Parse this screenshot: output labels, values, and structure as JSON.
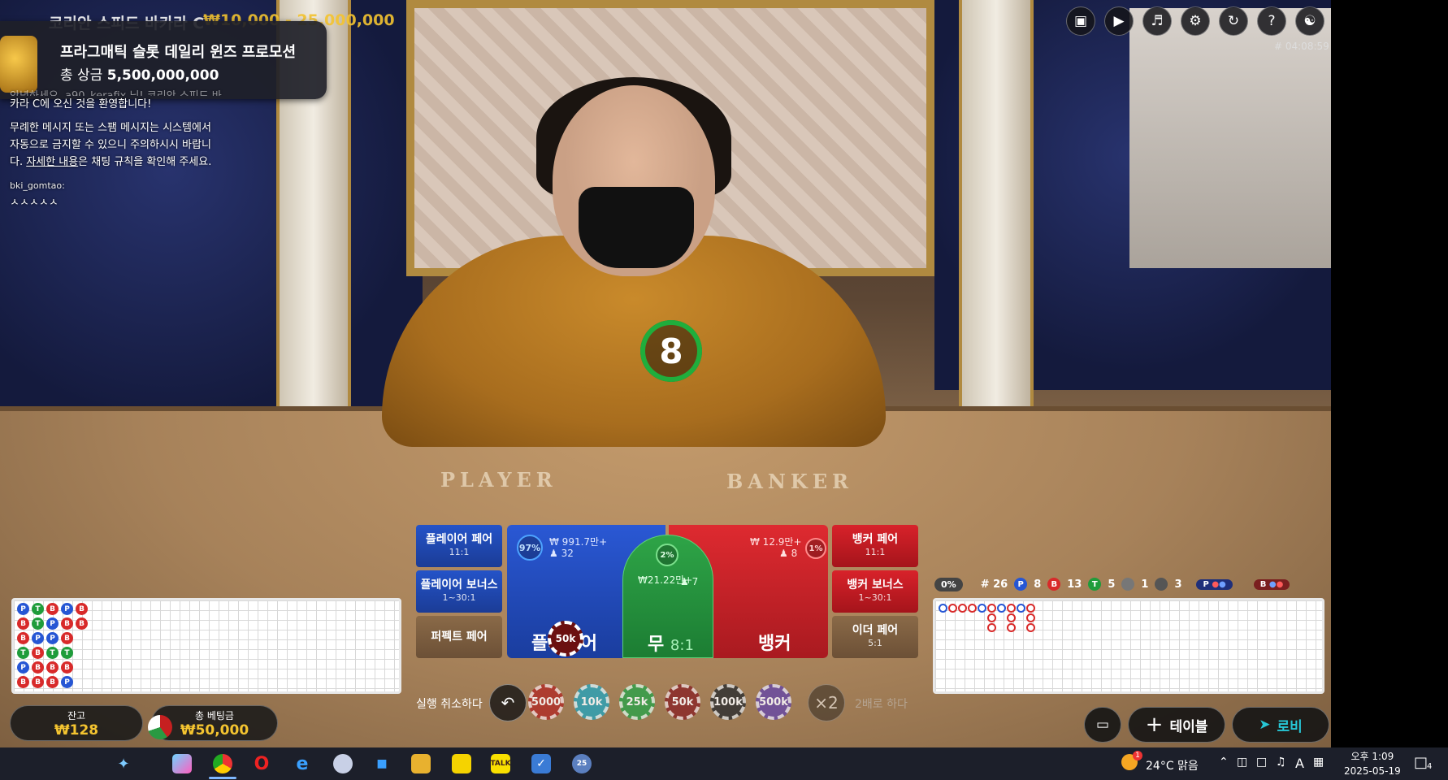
{
  "header": {
    "title": "코리안 스피드 바카라 C",
    "bet_limit": "₩10,000 - 25,000,000",
    "timestamp": "# 04:08:59"
  },
  "toolbar_icons": [
    "chat-icon",
    "video-icon",
    "sound-icon",
    "settings-icon",
    "history-icon",
    "help-icon",
    "headset-icon"
  ],
  "promo": {
    "title": "프라그매틱 슬롯 데일리 윈즈 프로모션",
    "prize_label": "총 상금",
    "prize_value": "5,500,000,000"
  },
  "chat": {
    "welcome_partial": "안녕하세요, a90_kerafix 님! 코리안 스피드 바",
    "welcome_line2": "카라 C에 오신 것을 환영합니다!",
    "notice_line1": "무례한 메시지 또는 스팸 메시지는 시스템에서",
    "notice_line2": "자동으로 금지할 수 있으니 주의하시시 바랍니",
    "notice_line3_a": "다. ",
    "notice_link": "자세한 내용",
    "notice_line3_b": "은 채팅 규칙을 확인해 주세요.",
    "user": "bki_gomtao:",
    "message": "ㅅㅅㅅㅅㅅ"
  },
  "felt": {
    "player": "PLAYER",
    "banker": "BANKER"
  },
  "timer": {
    "seconds": "8"
  },
  "side_bets": {
    "player_pair": {
      "label": "플레이어 페어",
      "odds": "11:1"
    },
    "player_bonus": {
      "label": "플레이어 보너스",
      "odds": "1~30:1"
    },
    "perfect_pair": {
      "label": "퍼펙트 페어"
    },
    "banker_pair": {
      "label": "뱅커 페어",
      "odds": "11:1"
    },
    "banker_bonus": {
      "label": "뱅커 보너스",
      "odds": "1~30:1"
    },
    "either_pair": {
      "label": "이더 페어",
      "odds": "5:1"
    }
  },
  "main_bets": {
    "player": {
      "label": "플레이어",
      "pct": "97%",
      "amount": "₩ 991.7만+",
      "players": "32"
    },
    "tie": {
      "label": "무",
      "odds": "8:1",
      "pct": "2%",
      "amount": "₩21.22만+",
      "players": "7"
    },
    "banker": {
      "label": "뱅커",
      "pct": "1%",
      "amount": "₩ 12.9만+",
      "players": "8"
    },
    "placed_chip": "50k"
  },
  "road_stats": {
    "zero_badge": "0%",
    "round": "# 26",
    "p_count": "8",
    "b_count": "13",
    "t_count": "5",
    "p_pair": "1",
    "b_pair": "3",
    "p_predict": "P",
    "b_predict": "B"
  },
  "bead_road": [
    [
      "P",
      "B",
      "B",
      "T",
      "P",
      "B"
    ],
    [
      "T",
      "T",
      "P",
      "B",
      "B",
      "B"
    ],
    [
      "B",
      "P",
      "P",
      "T",
      "B",
      "B"
    ],
    [
      "P",
      "B",
      "B",
      "T",
      "B",
      "P"
    ],
    [
      "B",
      "B",
      "",
      "",
      "",
      ""
    ]
  ],
  "wallet": {
    "balance_label": "잔고",
    "balance_value": "₩128",
    "total_bet_label": "총 베팅금",
    "total_bet_value": "₩50,000"
  },
  "controls": {
    "undo_label": "실행 취소하다",
    "undo_icon": "undo-icon",
    "double_icon_text": "×2",
    "double_label": "2배로 하다"
  },
  "chips": [
    {
      "label": "5000",
      "color": "#b0312a"
    },
    {
      "label": "10k",
      "color": "#2fa1b4"
    },
    {
      "label": "25k",
      "color": "#33a04a"
    },
    {
      "label": "50k",
      "color": "#8b2a2a"
    },
    {
      "label": "100k",
      "color": "#333333"
    },
    {
      "label": "500k",
      "color": "#6a4ba3"
    }
  ],
  "nav": {
    "table_label": "테이블",
    "lobby_label": "로비"
  },
  "taskbar": {
    "weather": "24°C 맑음",
    "time": "오후 1:09",
    "date": "2025-05-19",
    "notification_count": "4",
    "weather_badge": "1",
    "ime": "A"
  }
}
